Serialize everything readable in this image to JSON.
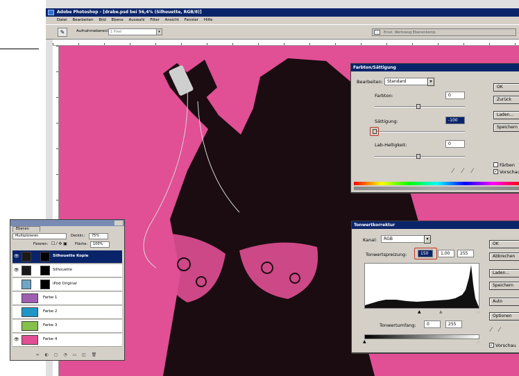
{
  "window": {
    "title": "Adobe Photoshop - [drabe.psd bei 56,4% (Silhouette, RGB/8)]",
    "menu": [
      "Datei",
      "Bearbeiten",
      "Bild",
      "Ebene",
      "Auswahl",
      "Filter",
      "Ansicht",
      "Fenster",
      "Hilfe"
    ]
  },
  "options_bar": {
    "tool_icon": "brush-tool-icon",
    "label": "Aufnahmebereich:",
    "select_value": "1 Pixel",
    "palette_well": "Einst.  Werkzeug  Ebenenkomp."
  },
  "hue_dialog": {
    "title": "Farbton/Sättigung",
    "edit_label": "Bearbeiten:",
    "edit_value": "Standard",
    "hue_label": "Farbton:",
    "hue_value": "0",
    "sat_label": "Sättigung:",
    "sat_value": "-100",
    "light_label": "Lab-Helligkeit:",
    "light_value": "0",
    "btn_ok": "OK",
    "btn_reset": "Zurück",
    "btn_load": "Laden...",
    "btn_save": "Speichern",
    "colorize": "Färben",
    "preview": "Vorschau"
  },
  "levels_dialog": {
    "title": "Tonwertkorrektur",
    "channel_label": "Kanal:",
    "channel_value": "RGB",
    "input_label": "Tonwertspreizung:",
    "input_black": "150",
    "input_gamma": "1,00",
    "input_white": "255",
    "output_label": "Tonwertumfang:",
    "output_black": "0",
    "output_white": "255",
    "btn_ok": "OK",
    "btn_cancel": "Abbrechen",
    "btn_load": "Laden...",
    "btn_save": "Speichern",
    "btn_auto": "Auto",
    "btn_options": "Optionen",
    "preview": "Vorschau"
  },
  "layers_panel": {
    "tab": "Ebenen",
    "blend_mode": "Multiplizieren",
    "opacity_label": "Deckkr.:",
    "opacity_value": "75%",
    "lock_label": "Fixieren:",
    "fill_label": "Fläche:",
    "fill_value": "100%",
    "layers": [
      {
        "name": "Silhouette Kopie",
        "color": "#1a1a1a"
      },
      {
        "name": "Silhouette",
        "color": "#1a1a1a"
      },
      {
        "name": "iPod Original",
        "color": "#6fa6c8"
      },
      {
        "name": "Farbe 1",
        "color": "#9e5fb0"
      },
      {
        "name": "Farbe 2",
        "color": "#1f95c8"
      },
      {
        "name": "Farbe 3",
        "color": "#86c04c"
      },
      {
        "name": "Farbe 4",
        "color": "#e14f95"
      }
    ]
  },
  "colors": {
    "canvas_background": "#e14f95",
    "silhouette": "#1a0c10",
    "title_bar": "#0a246a",
    "highlight": "#c0311f"
  }
}
